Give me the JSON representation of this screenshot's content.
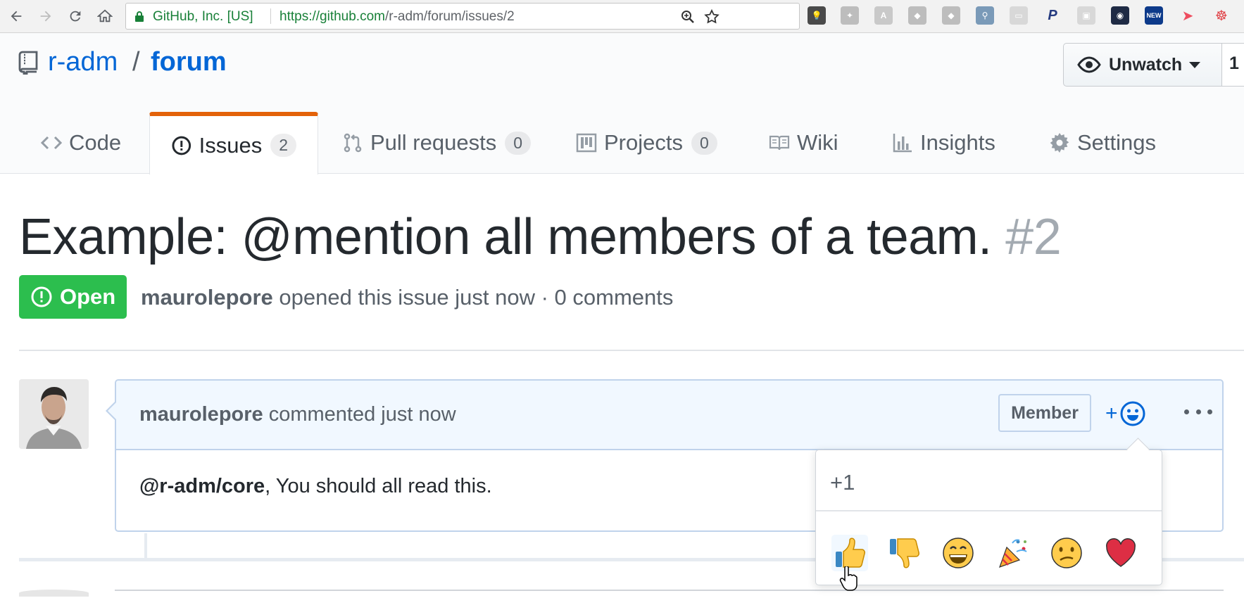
{
  "browser": {
    "site_identity": "GitHub, Inc. [US]",
    "url_host": "https://github.com",
    "url_path": "/r-adm/forum/issues/2"
  },
  "repo": {
    "owner": "r-adm",
    "separator": "/",
    "name": "forum",
    "watch_label": "Unwatch",
    "watch_count": "1"
  },
  "tabs": [
    {
      "label": "Code"
    },
    {
      "label": "Issues",
      "count": "2"
    },
    {
      "label": "Pull requests",
      "count": "0"
    },
    {
      "label": "Projects",
      "count": "0"
    },
    {
      "label": "Wiki"
    },
    {
      "label": "Insights"
    },
    {
      "label": "Settings"
    }
  ],
  "issue": {
    "title": "Example: @mention all members of a team.",
    "number": "#2",
    "state": "Open",
    "author": "maurolepore",
    "meta_text": " opened this issue just now · 0 comments"
  },
  "comment": {
    "author": "maurolepore",
    "action": " commented just now",
    "badge": "Member",
    "reaction_plus": "+",
    "body_mention": "@r-adm/core",
    "body_text": ", You should all read this."
  },
  "reactions_popover": {
    "label": "+1",
    "reactions": [
      "thumbs-up",
      "thumbs-down",
      "laugh",
      "hooray",
      "confused",
      "heart"
    ]
  },
  "colors": {
    "accent_blue": "#0366d6",
    "open_green": "#2cbe4e",
    "tab_orange": "#e36209"
  }
}
